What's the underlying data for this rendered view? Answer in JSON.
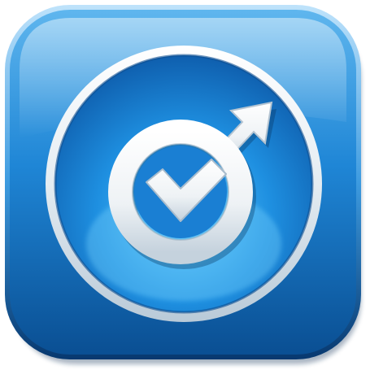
{
  "icon": {
    "name": "app-icon",
    "glyph": "checkmark-target-arrow-icon",
    "colors": {
      "background_light": "#5fb6ee",
      "background_mid": "#1f86d6",
      "background_dark": "#0a4f93",
      "ring_silver": "#e9eef2",
      "ring_shadow": "#8aa3b8",
      "glyph_white": "#f4f6f8",
      "glyph_shadow": "#9fb2c2",
      "glow": "#8ad8ff"
    }
  }
}
